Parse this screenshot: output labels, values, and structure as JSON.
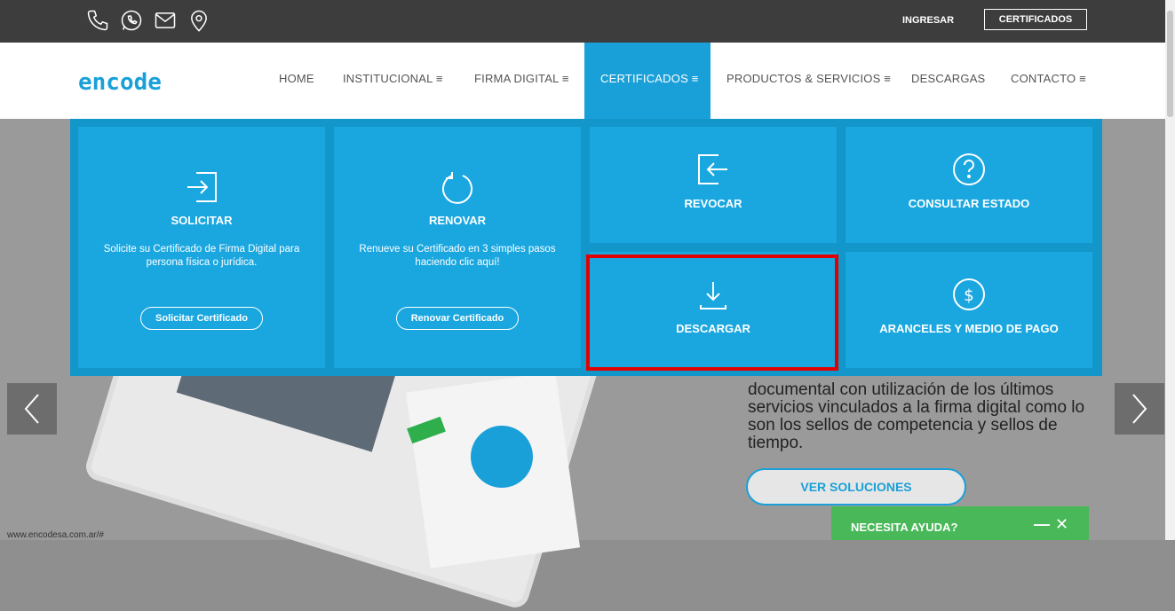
{
  "topbar": {
    "icons": [
      "phone-icon",
      "whatsapp-icon",
      "mail-icon",
      "location-pin-icon"
    ],
    "ingresar": "INGRESAR",
    "certificados_button": "CERTIFICADOS"
  },
  "nav": {
    "logo": "encode",
    "items": [
      {
        "label": "HOME"
      },
      {
        "label": "INSTITUCIONAL ≡"
      },
      {
        "label": "FIRMA DIGITAL ≡"
      },
      {
        "label": "CERTIFICADOS ≡"
      },
      {
        "label": "PRODUCTOS & SERVICIOS ≡"
      },
      {
        "label": "DESCARGAS"
      },
      {
        "label": "CONTACTO ≡"
      }
    ],
    "active_index": 3
  },
  "menu": {
    "solicitar": {
      "icon": "sign-in-icon",
      "title": "SOLICITAR",
      "desc": "Solicite su Certificado de Firma Digital para persona física o jurídica.",
      "button": "Solicitar Certificado"
    },
    "renovar": {
      "icon": "refresh-icon",
      "title": "RENOVAR",
      "desc": "Renueve su Certificado en 3 simples pasos haciendo clic aquí!",
      "button": "Renovar Certificado"
    },
    "revocar": {
      "icon": "sign-out-icon",
      "title": "REVOCAR"
    },
    "consultar": {
      "icon": "question-circle-icon",
      "title": "CONSULTAR ESTADO"
    },
    "descargar": {
      "icon": "download-icon",
      "title": "DESCARGAR"
    },
    "aranceles": {
      "icon": "dollar-circle-icon",
      "title": "ARANCELES Y MEDIO DE PAGO"
    }
  },
  "hero": {
    "text": "documental con utilización de los últimos servicios vinculados a la firma digital como lo son los sellos de competencia y sellos de tiempo.",
    "button": "VER SOLUCIONES"
  },
  "help": {
    "label": "NECESITA AYUDA?",
    "minimize": "—",
    "close": "✕"
  },
  "status_url": "www.encodesa.com.ar/#",
  "colors": {
    "accent": "#1aa7e0",
    "topbar": "#3d3d3d",
    "highlight": "#e10000",
    "help": "#48b858"
  }
}
